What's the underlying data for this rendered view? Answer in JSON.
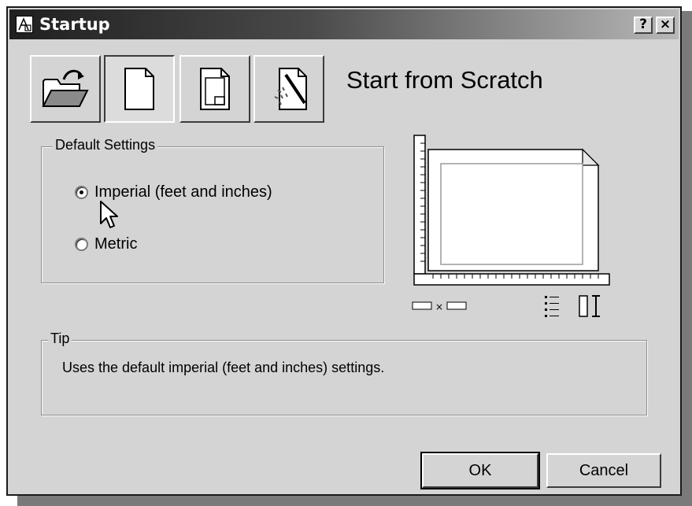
{
  "window": {
    "title": "Startup"
  },
  "titlebar_buttons": {
    "help": "?",
    "close": "×"
  },
  "toolbar": {
    "buttons": [
      {
        "name": "open-drawing",
        "icon": "open-folder-icon",
        "active": false
      },
      {
        "name": "start-from-scratch",
        "icon": "blank-page-icon",
        "active": true
      },
      {
        "name": "use-template",
        "icon": "template-page-icon",
        "active": false
      },
      {
        "name": "use-wizard",
        "icon": "wizard-icon",
        "active": false
      }
    ]
  },
  "section_title": "Start from Scratch",
  "default_settings": {
    "label": "Default Settings",
    "options": [
      {
        "label": "Imperial (feet and inches)",
        "checked": true
      },
      {
        "label": "Metric",
        "checked": false
      }
    ]
  },
  "preview": {
    "icon": "paper-preview-icon",
    "dimension_icon": "dimension-icon"
  },
  "tip": {
    "label": "Tip",
    "text": "Uses the default imperial (feet and inches) settings."
  },
  "buttons": {
    "ok": "OK",
    "cancel": "Cancel"
  }
}
